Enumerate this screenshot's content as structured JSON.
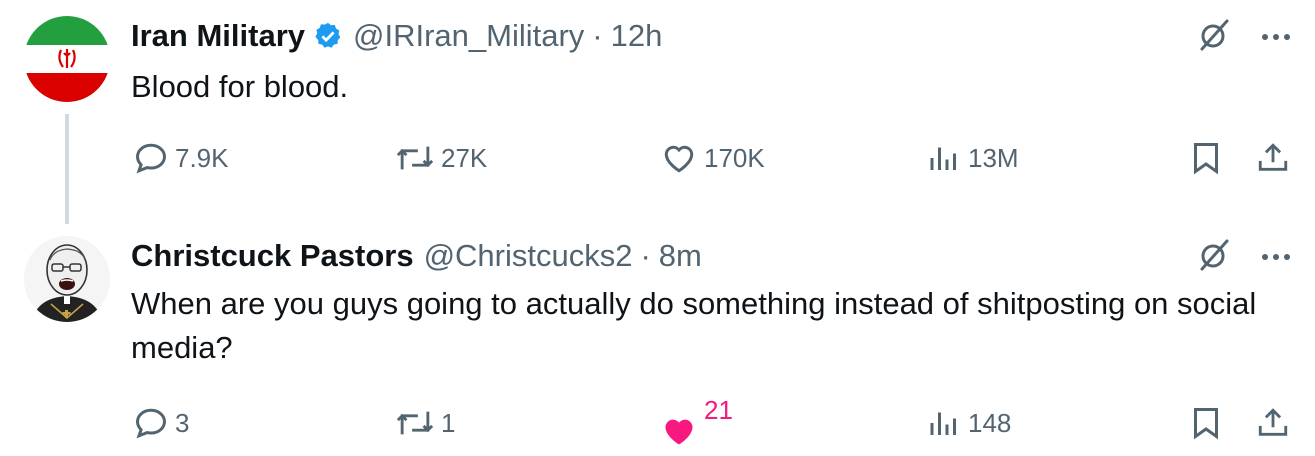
{
  "tweet1": {
    "name": "Iran Military",
    "handle": "@IRIran_Military",
    "separator": "·",
    "time": "12h",
    "text": "Blood for blood.",
    "replies": "7.9K",
    "reposts": "27K",
    "likes": "170K",
    "views": "13M",
    "avatar_icon": "iran-flag-avatar",
    "verified_icon": "verified-badge-icon"
  },
  "tweet2": {
    "name": "Christcuck Pastors",
    "handle": "@Christcucks2",
    "separator": "·",
    "time": "8m",
    "text": "When are you guys going to actually do something instead of shitposting on social media?",
    "replies": "3",
    "reposts": "1",
    "likes": "21",
    "views": "148",
    "avatar_icon": "wojak-avatar"
  },
  "icons": {
    "grok": "grok-icon",
    "more": "more-icon",
    "reply": "reply-icon",
    "repost": "repost-icon",
    "like": "heart-icon",
    "views": "views-icon",
    "bookmark": "bookmark-icon",
    "share": "share-icon"
  },
  "colors": {
    "text": "#0f1419",
    "secondary": "#536471",
    "verified": "#1d9bf0",
    "like_active": "#f91880",
    "thread_line": "#cfd9de"
  }
}
